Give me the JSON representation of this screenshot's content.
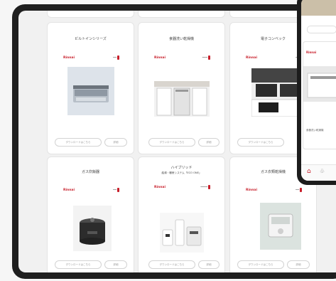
{
  "products": [
    {
      "title": "ビルトインシリーズ",
      "brand": "Rinnai",
      "btn1": "ダウンロードはこちら",
      "btn2": "詳細"
    },
    {
      "title": "食器洗い乾燥機",
      "brand": "Rinnai",
      "btn1": "ダウンロードはこちら",
      "btn2": "詳細"
    },
    {
      "title": "電子コンベック",
      "brand": "Rinnai",
      "btn1": "ダウンロードはこちら",
      "btn2": "詳細"
    },
    {
      "title": "ガス炊飯器",
      "brand": "Rinnai",
      "btn1": "ダウンロードはこちら",
      "btn2": "詳細"
    },
    {
      "title": "ハイブリッド",
      "subtitle": "給湯・暖房システム「ECO ONE」",
      "brand": "Rinnai",
      "btn1": "ダウンロードはこちら",
      "btn2": "詳細"
    },
    {
      "title": "ガス衣類乾燥機",
      "brand": "Rinnai",
      "btn1": "ダウンロードはこちら",
      "btn2": "詳細"
    }
  ],
  "phone": {
    "brand": "Rinnai",
    "item_label": "食器洗い乾燥機"
  }
}
